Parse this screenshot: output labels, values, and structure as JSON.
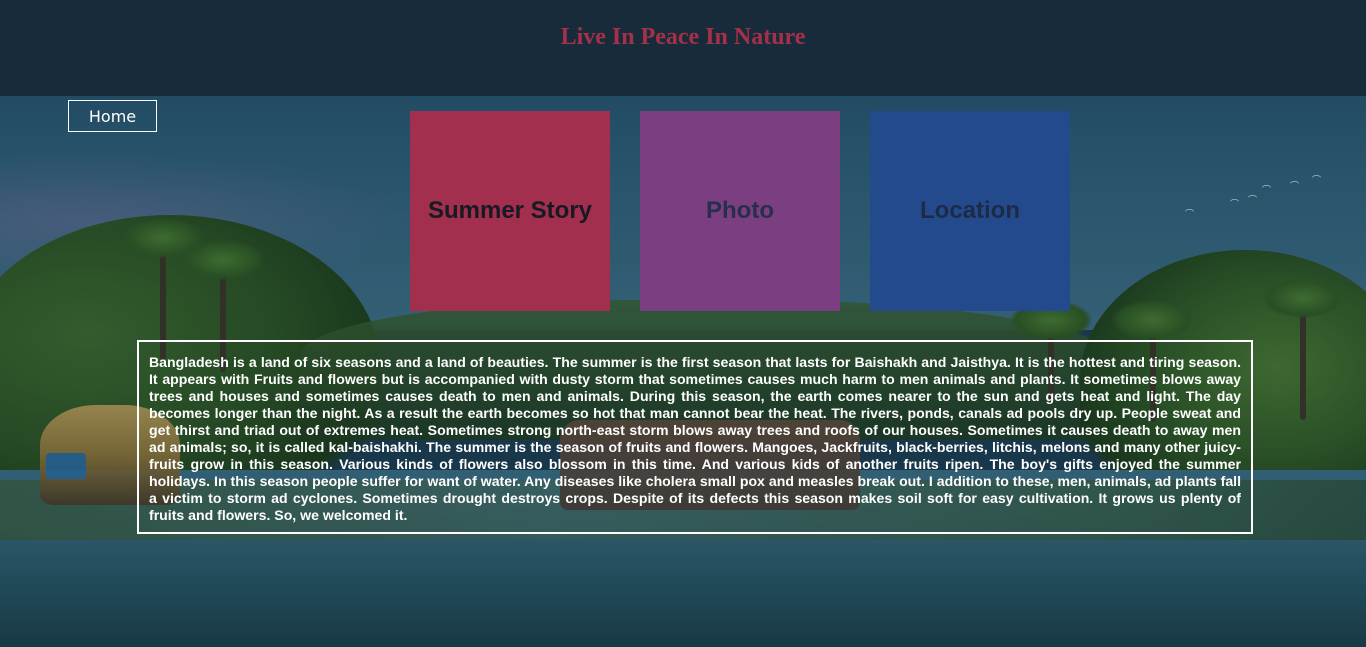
{
  "header": {
    "title": "Live In Peace In Nature",
    "title_color": "#a4304a",
    "background_color": "#182b3a"
  },
  "nav": {
    "home_label": "Home"
  },
  "tiles": [
    {
      "label": "Summer Story",
      "color": "#a22f4d"
    },
    {
      "label": "Photo",
      "color": "#7b3e81"
    },
    {
      "label": "Location",
      "color": "#244a8e"
    }
  ],
  "story": {
    "text": "Bangladesh is a land of six seasons and a land of beauties. The summer is the first season that lasts for Baishakh and Jaisthya. It is the hottest and tiring season. It appears with Fruits and flowers but is accompanied with dusty storm that sometimes causes much harm to men animals and plants. It sometimes blows away trees and houses and sometimes causes death to men and animals. During this season, the earth comes nearer to the sun and gets heat and light. The day becomes longer than the night. As a result the earth becomes so hot that man cannot bear the heat. The rivers, ponds, canals ad pools dry up. People sweat and get thirst and triad out of extremes heat. Sometimes strong north-east storm blows away trees and roofs of our houses. Sometimes it causes death to away men ad animals; so, it is called kal-baishakhi. The summer is the season of fruits and flowers. Mangoes, Jackfruits, black-berries, litchis, melons and many other juicy-fruits grow in this season. Various kinds of flowers also blossom in this time. And various kids of another fruits ripen. The boy's gifts enjoyed the summer holidays. In this season people suffer for want of water. Any diseases like cholera small pox and measles break out. I addition to these, men, animals, ad plants fall a victim to storm ad cyclones. Sometimes drought destroys crops. Despite of its defects this season makes soil soft for easy cultivation. It grows us plenty of fruits and flowers. So, we welcomed it."
  },
  "background": {
    "description_icon": "backwater-landscape-image"
  }
}
